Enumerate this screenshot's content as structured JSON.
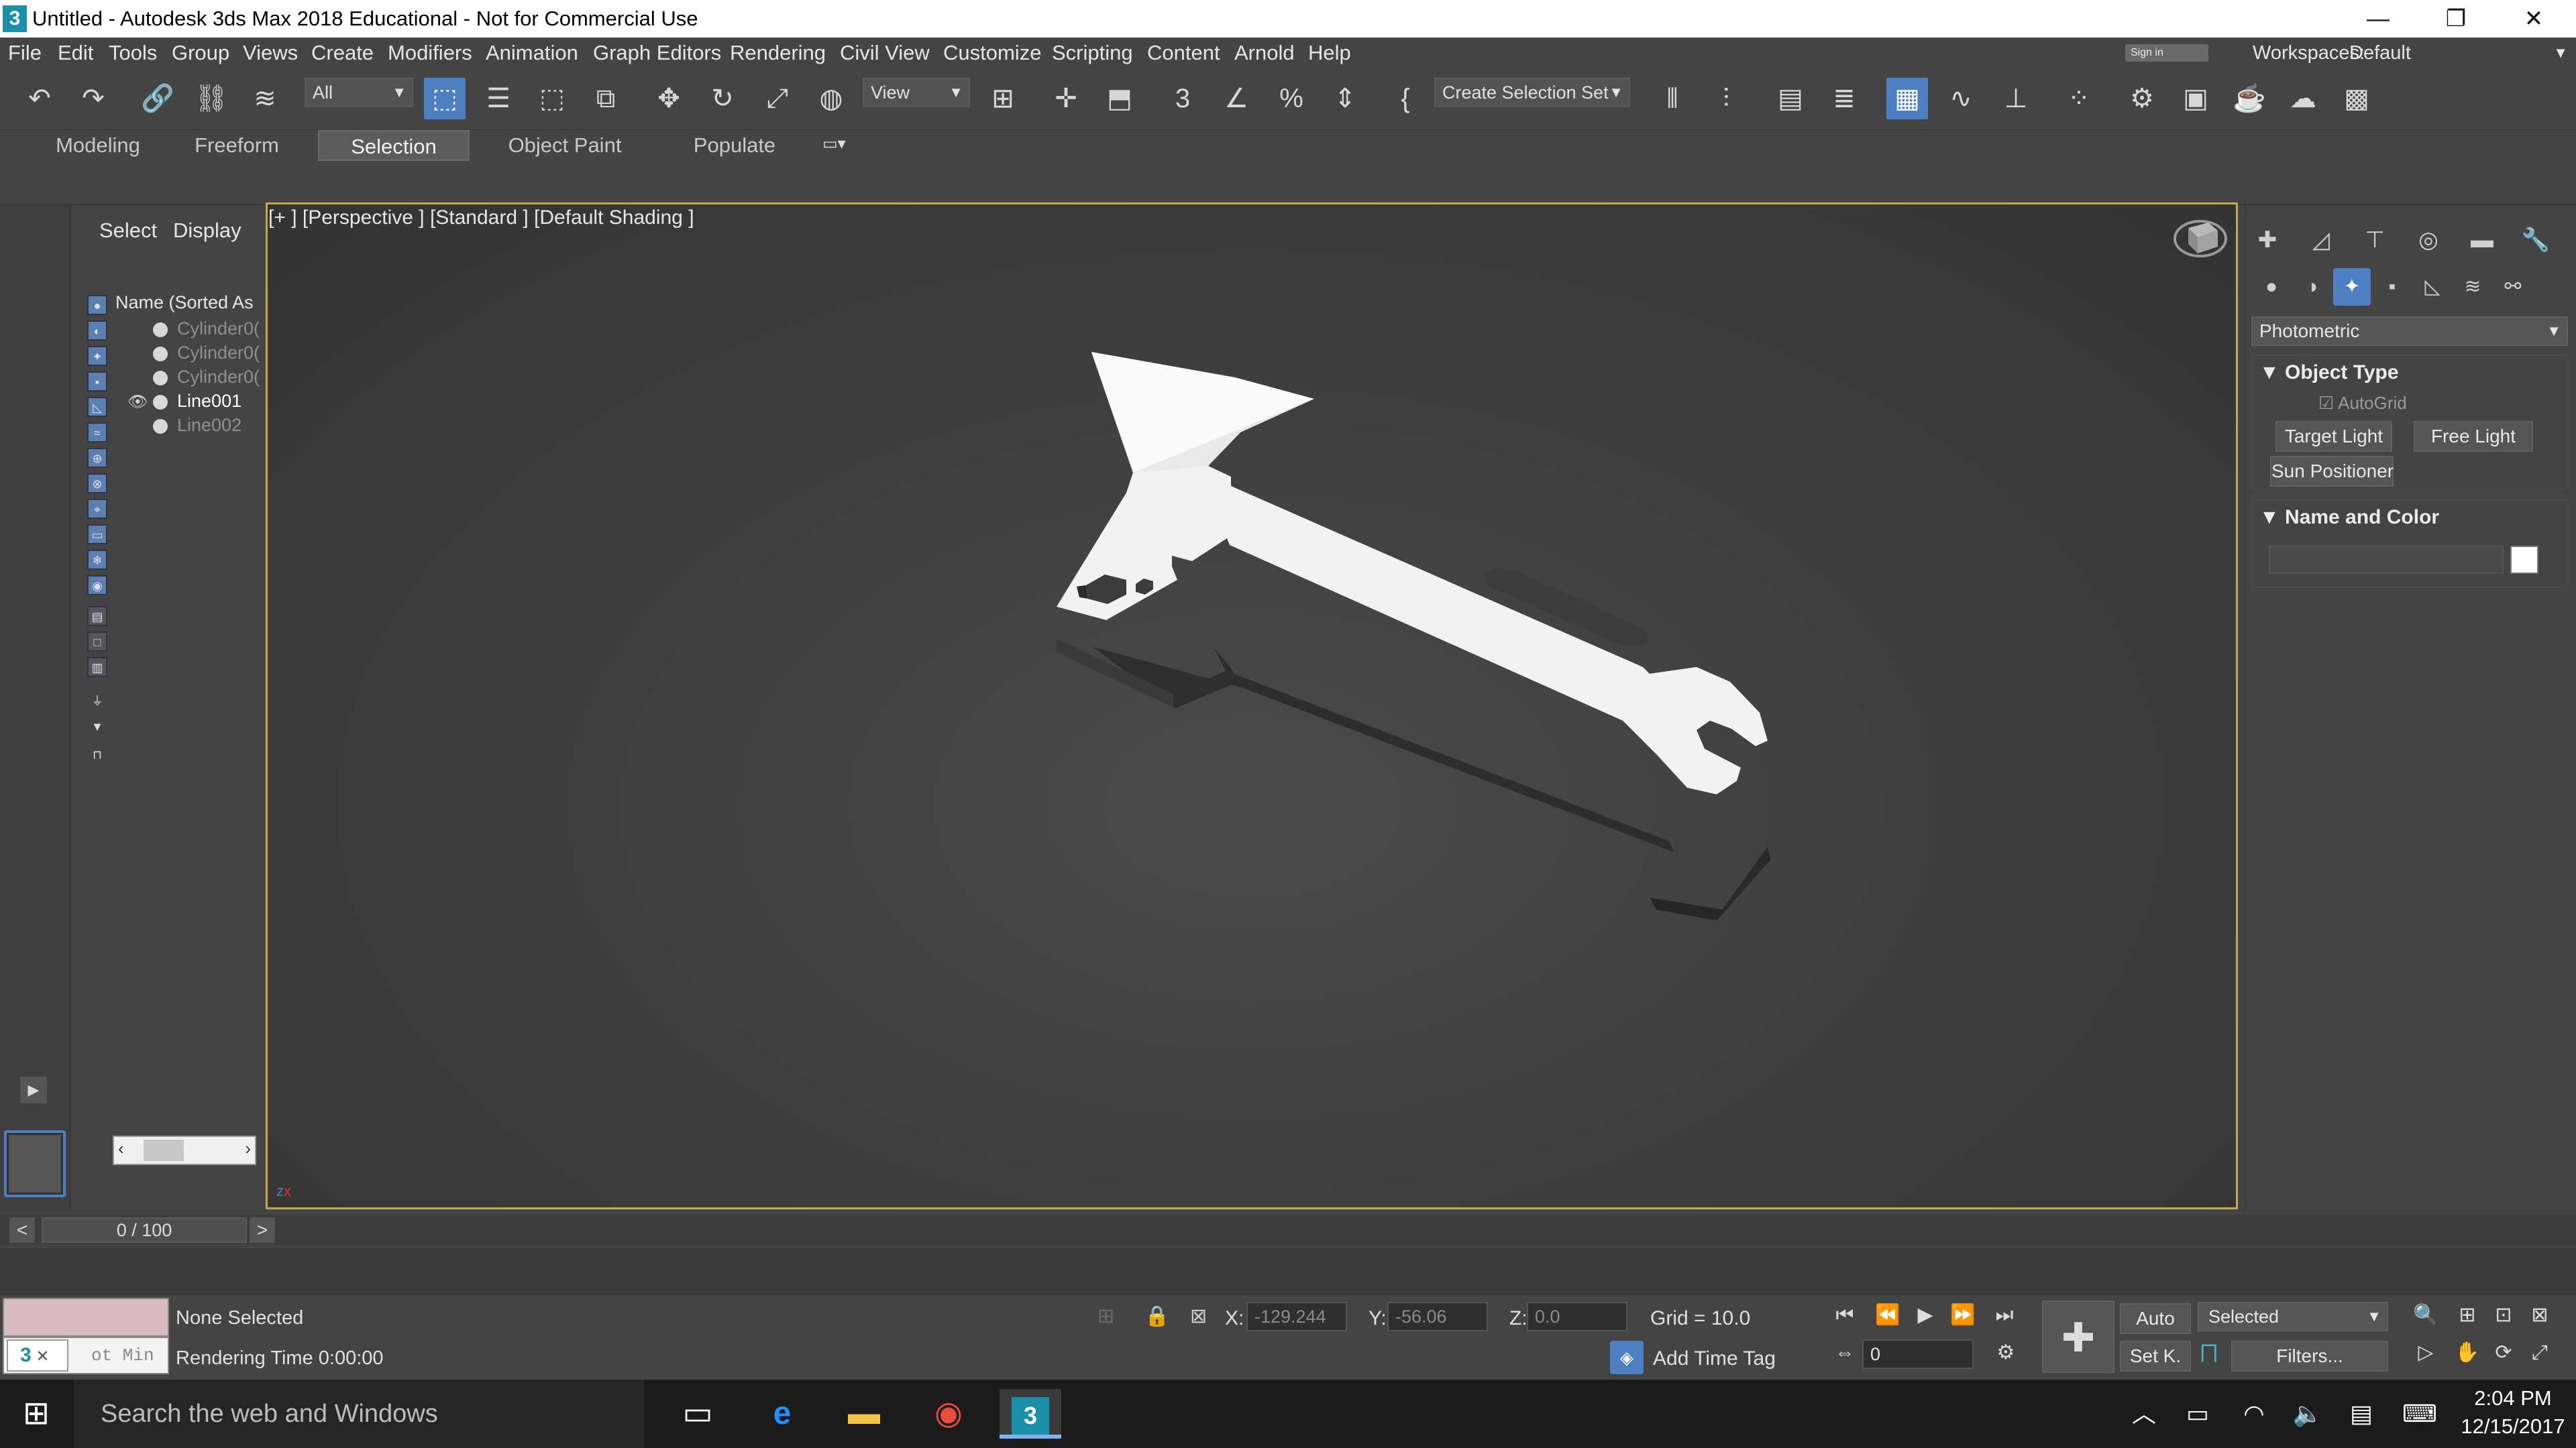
{
  "window": {
    "title": "Untitled - Autodesk 3ds Max 2018 Educational - Not for Commercial Use",
    "app_icon_text": "3",
    "minimize_glyph": "—",
    "restore_glyph": "❐",
    "close_glyph": "✕"
  },
  "menu": [
    "File",
    "Edit",
    "Tools",
    "Group",
    "Views",
    "Create",
    "Modifiers",
    "Animation",
    "Graph Editors",
    "Rendering",
    "Civil View",
    "Customize",
    "Scripting",
    "Content",
    "Arnold",
    "Help"
  ],
  "account": {
    "sign_in_label": "Sign in",
    "workspaces_label": "Workspaces:",
    "workspace_value": "Default"
  },
  "toolbar": {
    "filter_value": "All",
    "reference_value": "View",
    "selection_set_placeholder": "Create Selection Set"
  },
  "ribbon_tabs": [
    "Modeling",
    "Freeform",
    "Selection",
    "Object Paint",
    "Populate"
  ],
  "ribbon_active": "Selection",
  "scene_explorer": {
    "tabs": [
      "Select",
      "Display"
    ],
    "header": "Name (Sorted As",
    "items": [
      {
        "name": "Cylinder0(",
        "selected": false
      },
      {
        "name": "Cylinder0(",
        "selected": false
      },
      {
        "name": "Cylinder0(",
        "selected": false
      },
      {
        "name": "Line001",
        "selected": true
      },
      {
        "name": "Line002",
        "selected": false
      }
    ]
  },
  "viewport": {
    "label": "[+ ] [Perspective ]  [Standard ]  [Default Shading ]",
    "axis_z": "z",
    "axis_x": "x"
  },
  "command_panel": {
    "category_value": "Photometric",
    "object_type_title": "Object Type",
    "autogrid_label": "AutoGrid",
    "buttons": [
      "Target Light",
      "Free Light",
      "Sun Positioner"
    ],
    "name_color_title": "Name and Color",
    "name_value": "",
    "swatch_color": "#ffffff"
  },
  "time_slider": {
    "frame_text": "0 / 100",
    "prev": "<",
    "next": ">"
  },
  "status": {
    "selection": "None Selected",
    "rendering_time": "Rendering Time  0:00:00",
    "maxscript_text": "ot Min",
    "x_label": "X:",
    "x_value": "-129.244",
    "y_label": "Y:",
    "y_value": "-56.06",
    "z_label": "Z:",
    "z_value": "0.0",
    "grid": "Grid = 10.0",
    "add_time_tag": "Add Time Tag",
    "auto_label": "Auto",
    "setkey_label": "Set K.",
    "key_filter_value": "Selected",
    "filters_label": "Filters...",
    "current_frame": "0"
  },
  "taskbar": {
    "search_placeholder": "Search the web and Windows",
    "time": "2:04 PM",
    "date": "12/15/2017"
  },
  "colors": {
    "accent": "#4d7fc2",
    "viewport_border": "#c5a84a",
    "ui_bg": "#444444"
  }
}
